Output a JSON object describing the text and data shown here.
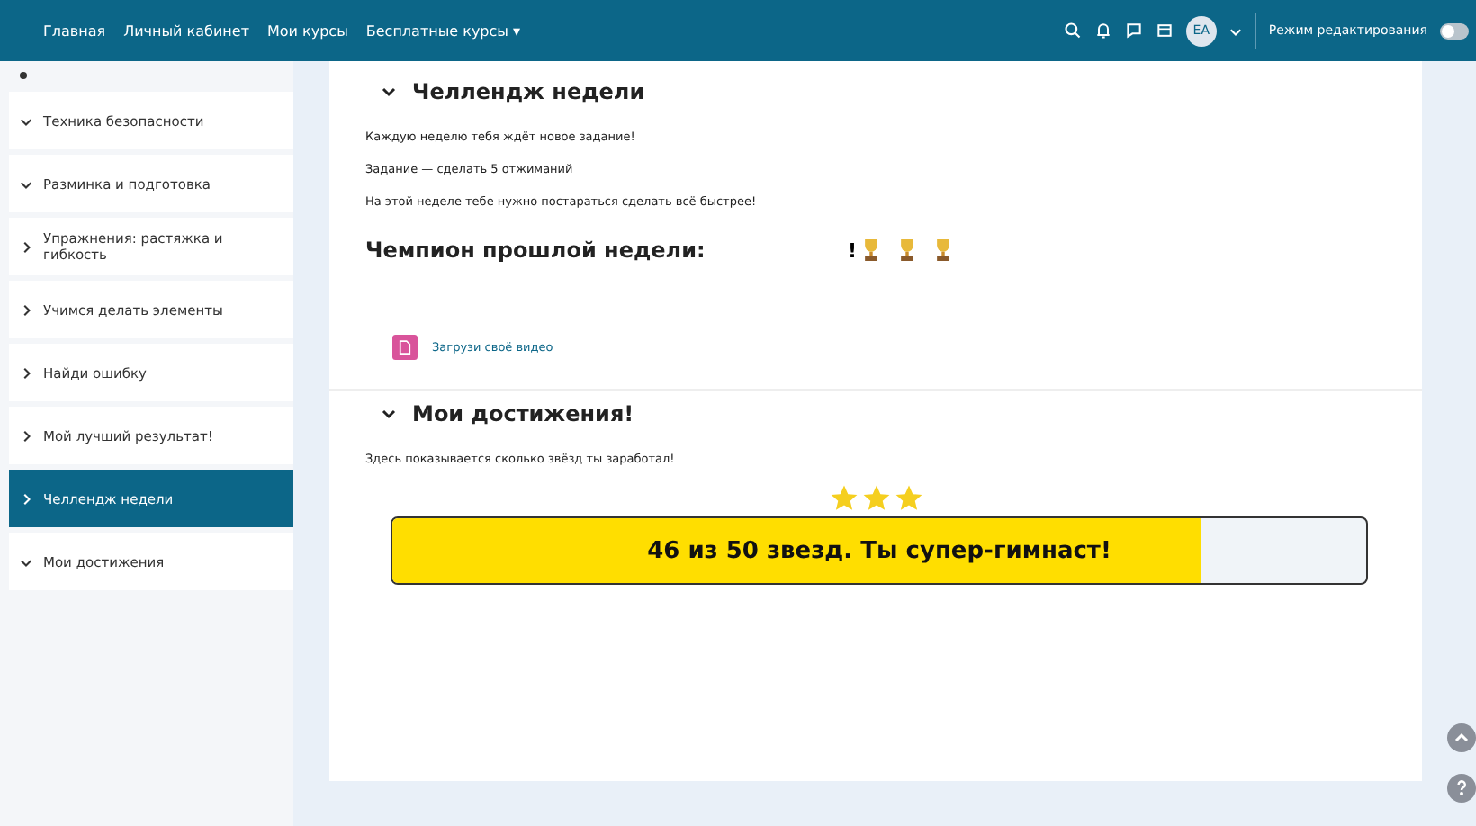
{
  "navbar": {
    "links": [
      {
        "label": "Главная"
      },
      {
        "label": "Личный кабинет"
      },
      {
        "label": "Мои курсы"
      },
      {
        "label": "Бесплатные курсы ▾"
      }
    ],
    "avatar_initials": "ЕА",
    "edit_mode": {
      "label": "Режим редактирования",
      "on": false
    }
  },
  "sidebar": {
    "items": [
      {
        "label": "Техника безопасности",
        "expanded": true,
        "selected": false
      },
      {
        "label": "Разминка и подготовка",
        "expanded": true,
        "selected": false
      },
      {
        "label": "Упражнения: растяжка и гибкость",
        "expanded": false,
        "selected": false
      },
      {
        "label": "Учимся делать элементы",
        "expanded": false,
        "selected": false
      },
      {
        "label": "Найди ошибку",
        "expanded": false,
        "selected": false
      },
      {
        "label": "Мой лучший результат!",
        "expanded": false,
        "selected": false
      },
      {
        "label": "Челлендж недели",
        "expanded": false,
        "selected": true
      },
      {
        "label": "Мои достижения",
        "expanded": true,
        "selected": false
      }
    ]
  },
  "challenge": {
    "title": "Челлендж недели",
    "paragraphs": [
      "Каждую неделю тебя ждёт новое задание!",
      "Задание — сделать 5 отжиманий",
      "На этой неделе тебе нужно постараться сделать всё быстрее!"
    ],
    "champion_label": "Чемпион прошлой недели:",
    "champion_mark": "!",
    "trophies": [
      {
        "kind": "trophy"
      },
      {
        "kind": "trophy"
      },
      {
        "kind": "trophy"
      }
    ],
    "upload_link": "Загрузи своё видео"
  },
  "achievements": {
    "title": "Мои достижения!",
    "text": "Здесь показывается сколько звёзд ты заработал!",
    "stars": 3,
    "progress": {
      "level": 0.83,
      "label": "46 из 50 звезд. Ты супер-гимнаст!"
    }
  }
}
